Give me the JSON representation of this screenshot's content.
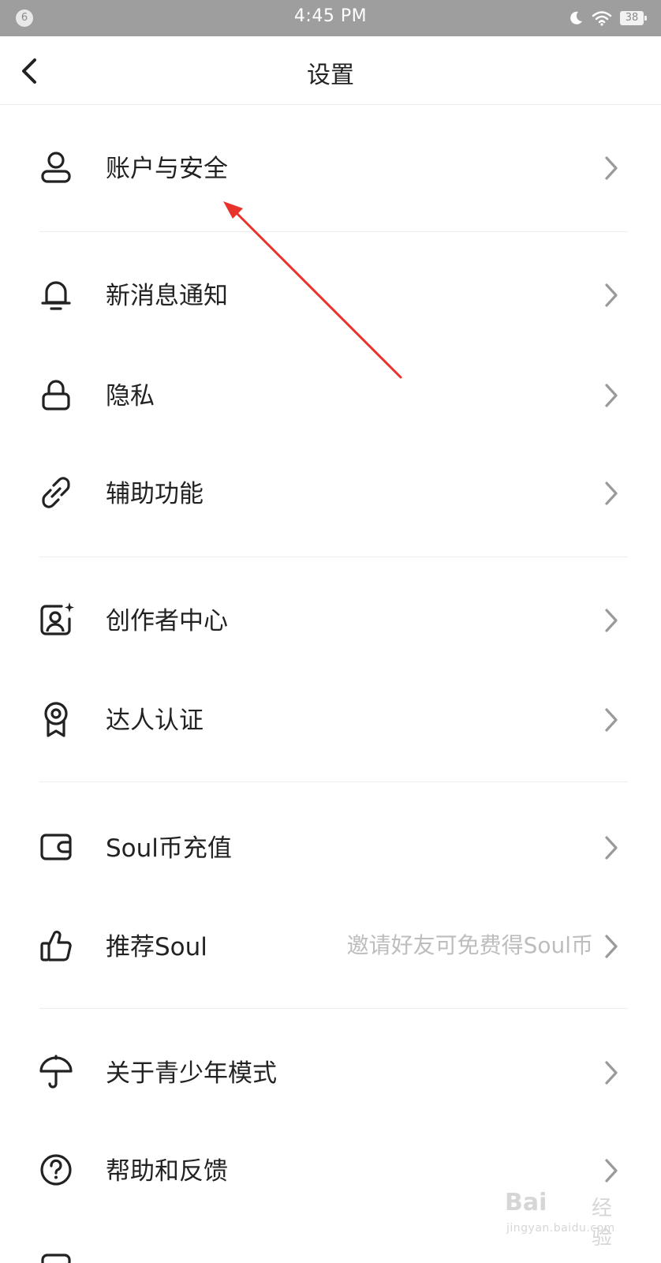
{
  "status_bar": {
    "notification_count": "6",
    "time": "4:45 PM",
    "battery": "38",
    "icons": [
      "moon-icon",
      "wifi-icon",
      "battery-icon"
    ]
  },
  "nav": {
    "title": "设置",
    "back_icon": "chevron-left-icon"
  },
  "settings": [
    {
      "label": "账户与安全",
      "icon": "user-icon"
    },
    {
      "label": "新消息通知",
      "icon": "bell-icon"
    },
    {
      "label": "隐私",
      "icon": "lock-icon"
    },
    {
      "label": "辅助功能",
      "icon": "link-icon"
    },
    {
      "label": "创作者中心",
      "icon": "creator-portrait-icon"
    },
    {
      "label": "达人认证",
      "icon": "badge-icon"
    },
    {
      "label": "Soul币充值",
      "icon": "wallet-icon"
    },
    {
      "label": "推荐Soul",
      "icon": "thumbs-up-icon",
      "hint": "邀请好友可免费得Soul币"
    },
    {
      "label": "关于青少年模式",
      "icon": "umbrella-icon"
    },
    {
      "label": "帮助和反馈",
      "icon": "help-circle-icon"
    }
  ],
  "annotation": {
    "color": "#e8322b",
    "target": "账户与安全"
  },
  "watermark": {
    "main": "Bai",
    "cn": "经验",
    "sub": "jingyan.baidu.com"
  }
}
